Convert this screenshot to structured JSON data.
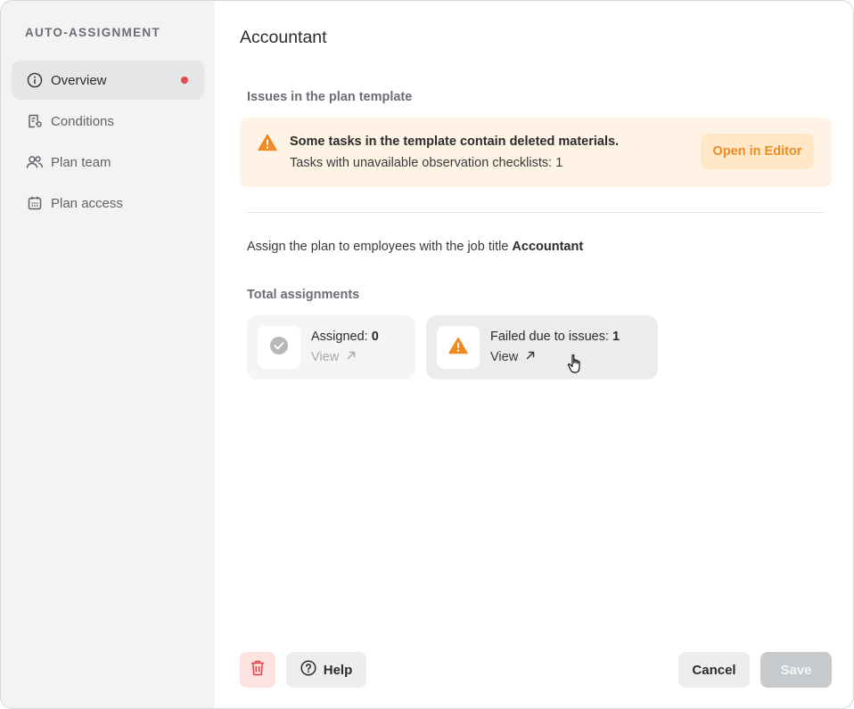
{
  "sidebar": {
    "heading": "AUTO-ASSIGNMENT",
    "items": [
      {
        "label": "Overview",
        "icon": "info-icon",
        "active": true,
        "has_alert_dot": true
      },
      {
        "label": "Conditions",
        "icon": "conditions-icon"
      },
      {
        "label": "Plan team",
        "icon": "people-icon"
      },
      {
        "label": "Plan access",
        "icon": "calendar-icon"
      }
    ]
  },
  "main": {
    "title": "Accountant",
    "issues_label": "Issues in the plan template",
    "alert": {
      "title": "Some tasks in the template contain deleted materials.",
      "subtitle": "Tasks with unavailable observation checklists: 1",
      "action_label": "Open in Editor"
    },
    "assign_prefix": "Assign the plan to employees with the job title ",
    "assign_job_title": "Accountant",
    "totals_label": "Total assignments",
    "cards": [
      {
        "label": "Assigned: ",
        "value": "0",
        "view_label": "View"
      },
      {
        "label": "Failed due to issues: ",
        "value": "1",
        "view_label": "View"
      }
    ]
  },
  "footer": {
    "help_label": "Help",
    "cancel_label": "Cancel",
    "save_label": "Save"
  },
  "colors": {
    "accent_orange": "#f08a24",
    "alert_bg": "#fff3e6",
    "danger": "#e5484d"
  }
}
